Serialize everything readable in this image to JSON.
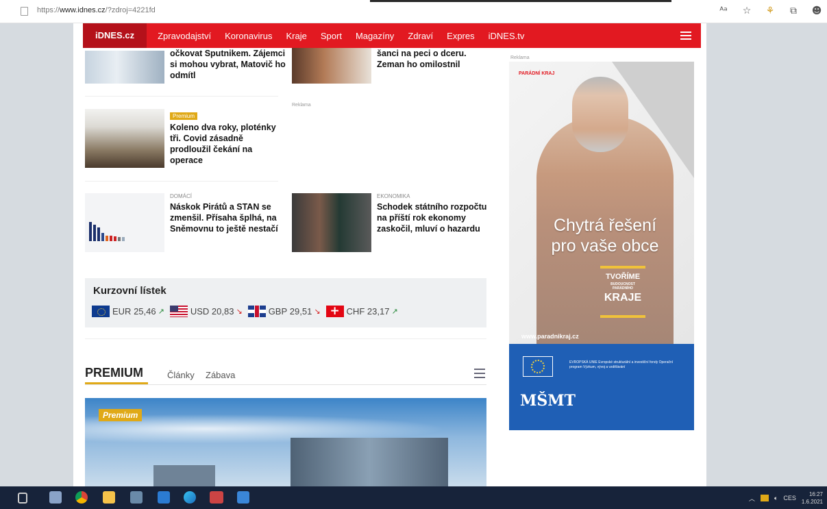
{
  "browser": {
    "url_prefix": "https://",
    "url_host": "www.idnes.cz",
    "url_path": "/?zdroj=4221fd",
    "icons": [
      "reader-icon",
      "favorite-icon",
      "shield-icon",
      "collections-icon",
      "profile-icon"
    ]
  },
  "nav": {
    "logo": "iDNES.cz",
    "items": [
      "Zpravodajství",
      "Koronavirus",
      "Kraje",
      "Sport",
      "Magazíny",
      "Zdraví",
      "Expres",
      "iDNES.tv"
    ]
  },
  "articles": [
    {
      "category": "",
      "badge": "",
      "headline": "očkovat Sputnikem. Zájemci si mohou vybrat, Matovič ho odmítl"
    },
    {
      "category": "",
      "badge": "",
      "headline": "šanci na peci o dceru. Zeman ho omilostnil"
    },
    {
      "category": "",
      "badge": "Premium",
      "headline": "Koleno dva roky, ploténky tři. Covid zásadně prodloužil čekání na operace"
    },
    {
      "category": "DOMÁCÍ",
      "badge": "",
      "headline": "Náskok Pirátů a STAN se zmenšil. Přísaha šplhá, na Sněmovnu to ještě nestačí"
    },
    {
      "category": "EKONOMIKA",
      "badge": "",
      "headline": "Schodek státního rozpočtu na příští rok ekonomy zaskočil, mluví o hazardu"
    }
  ],
  "labels": {
    "ad_small": "Reklama",
    "ad_mid": "Reklama"
  },
  "exchange": {
    "title": "Kurzovní lístek",
    "rates": [
      {
        "code": "EUR",
        "value": "25,46",
        "trend": "up",
        "arrow": "↗",
        "flag": "eu"
      },
      {
        "code": "USD",
        "value": "20,83",
        "trend": "down",
        "arrow": "↘",
        "flag": "us"
      },
      {
        "code": "GBP",
        "value": "29,51",
        "trend": "down",
        "arrow": "↘",
        "flag": "gb"
      },
      {
        "code": "CHF",
        "value": "23,17",
        "trend": "up",
        "arrow": "↗",
        "flag": "ch"
      }
    ]
  },
  "premium": {
    "title": "PREMIUM",
    "tabs": [
      "Články",
      "Zábava"
    ],
    "hero_badge": "Premium"
  },
  "ad": {
    "brand": "PARÁDNÍ KRAJ",
    "slogan_line1": "Chytrá řešení",
    "slogan_line2": "pro vaše obce",
    "tag_top": "TVOŘÍME",
    "tag_mid": "BUDOUCNOST PARÁDNÍHO",
    "tag_bottom": "KRAJE",
    "website": "www.paradnikraj.cz",
    "eu_text": "EVROPSKÁ UNIE Evropské strukturální a investiční fondy Operační program Výzkum, vývoj a vzdělávání",
    "msmt": "MŠMT"
  },
  "taskbar": {
    "tray_lang": "CES",
    "time": "16:27",
    "date": "1.6.2021"
  },
  "colors": {
    "nav_red": "#e21921",
    "premium_gold": "#e0a917",
    "ad_blue": "#1f5fb5",
    "taskbar": "#17233a"
  }
}
